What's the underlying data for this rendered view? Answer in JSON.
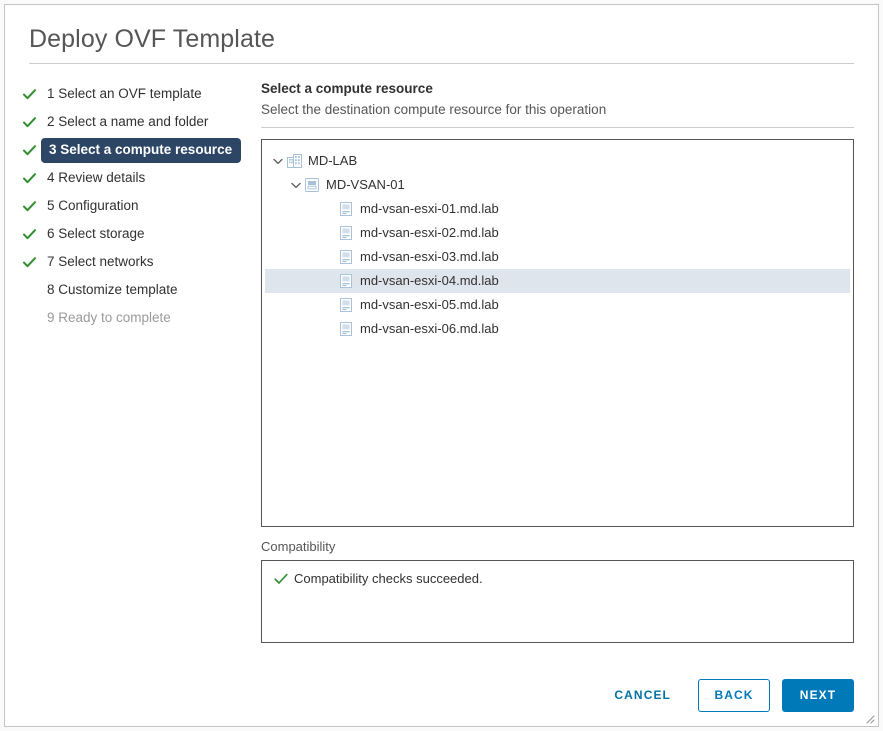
{
  "dialog": {
    "title": "Deploy OVF Template"
  },
  "steps": [
    {
      "label": "1 Select an OVF template",
      "state": "done"
    },
    {
      "label": "2 Select a name and folder",
      "state": "done"
    },
    {
      "label": "3 Select a compute resource",
      "state": "current"
    },
    {
      "label": "4 Review details",
      "state": "done"
    },
    {
      "label": "5 Configuration",
      "state": "done"
    },
    {
      "label": "6 Select storage",
      "state": "done"
    },
    {
      "label": "7 Select networks",
      "state": "done"
    },
    {
      "label": "8 Customize template",
      "state": "pending"
    },
    {
      "label": "9 Ready to complete",
      "state": "disabled"
    }
  ],
  "pane": {
    "title": "Select a compute resource",
    "subtitle": "Select the destination compute resource for this operation"
  },
  "tree": [
    {
      "label": "MD-LAB",
      "icon": "datacenter-icon",
      "level": 1,
      "expanded": true,
      "selected": false
    },
    {
      "label": "MD-VSAN-01",
      "icon": "cluster-icon",
      "level": 2,
      "expanded": true,
      "selected": false
    },
    {
      "label": "md-vsan-esxi-01.md.lab",
      "icon": "host-icon",
      "level": 3,
      "expanded": null,
      "selected": false
    },
    {
      "label": "md-vsan-esxi-02.md.lab",
      "icon": "host-icon",
      "level": 3,
      "expanded": null,
      "selected": false
    },
    {
      "label": "md-vsan-esxi-03.md.lab",
      "icon": "host-icon",
      "level": 3,
      "expanded": null,
      "selected": false
    },
    {
      "label": "md-vsan-esxi-04.md.lab",
      "icon": "host-icon",
      "level": 3,
      "expanded": null,
      "selected": true
    },
    {
      "label": "md-vsan-esxi-05.md.lab",
      "icon": "host-icon",
      "level": 3,
      "expanded": null,
      "selected": false
    },
    {
      "label": "md-vsan-esxi-06.md.lab",
      "icon": "host-icon",
      "level": 3,
      "expanded": null,
      "selected": false
    }
  ],
  "compatibility": {
    "label": "Compatibility",
    "message": "Compatibility checks succeeded."
  },
  "footer": {
    "cancel_label": "CANCEL",
    "back_label": "BACK",
    "next_label": "NEXT"
  },
  "colors": {
    "accent_blue": "#0079b8",
    "link_blue": "#0072a3",
    "current_step_bg": "#2d4665",
    "success_green": "#2f8f2f",
    "selection_bg": "#dfe5ec",
    "icon_blue": "#a8c3d9"
  }
}
